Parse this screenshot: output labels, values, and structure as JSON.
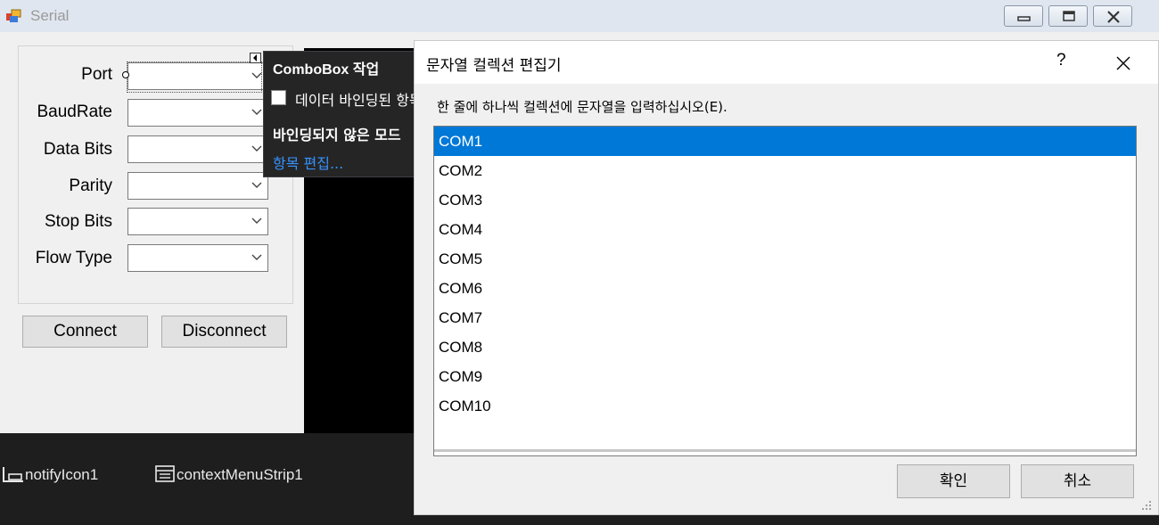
{
  "window": {
    "title": "Serial",
    "icons": [
      "app-icon",
      "minimize-icon",
      "maximize-icon",
      "close-icon"
    ]
  },
  "form": {
    "labels": [
      "Port",
      "BaudRate",
      "Data Bits",
      "Parity",
      "Stop Bits",
      "Flow Type"
    ],
    "connect_label": "Connect",
    "disconnect_label": "Disconnect"
  },
  "tasks_popup": {
    "title": "ComboBox 작업",
    "checkbox_label": "데이터 바인딩된 항목 사용",
    "unbound_label": "바인딩되지 않은 모드",
    "edit_items_link": "항목 편집..."
  },
  "tray": {
    "items": [
      "notifyIcon1",
      "contextMenuStrip1"
    ]
  },
  "dialog": {
    "title": "문자열 컬렉션 편집기",
    "help_label": "?",
    "instruction": "한 줄에 하나씩 컬렉션에 문자열을 입력하십시오(E).",
    "items": [
      "COM1",
      "COM2",
      "COM3",
      "COM4",
      "COM5",
      "COM6",
      "COM7",
      "COM8",
      "COM9",
      "COM10"
    ],
    "selected_item": "COM1",
    "ok_label": "확인",
    "cancel_label": "취소"
  },
  "colors": {
    "selection": "#0078d7",
    "link": "#3794ff",
    "dark_background": "#1e1e1e"
  }
}
